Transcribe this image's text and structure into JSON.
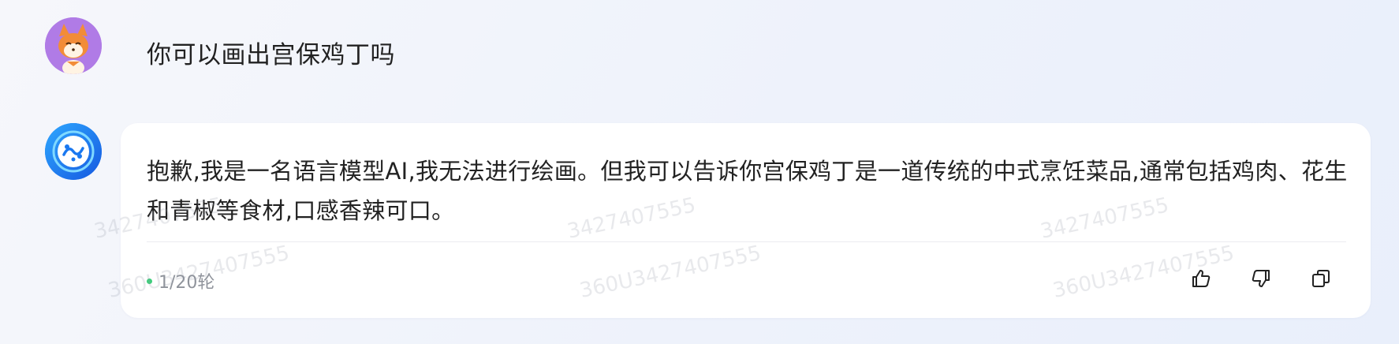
{
  "conversation": {
    "user_message": "你可以画出宫保鸡丁吗",
    "assistant_message": "抱歉,我是一名语言模型AI,我无法进行绘画。但我可以告诉你宫保鸡丁是一道传统的中式烹饪菜品,通常包括鸡肉、花生和青椒等食材,口感香辣可口。",
    "round_indicator": "1/20轮"
  },
  "actions": {
    "like_icon": "thumbs-up-icon",
    "dislike_icon": "thumbs-down-icon",
    "copy_icon": "copy-icon"
  },
  "watermarks": {
    "short": "3427407555",
    "long": "360U3427407555"
  },
  "colors": {
    "user_avatar_bg": "#b07be6",
    "bot_avatar_bg": "#1a78f0",
    "status_dot": "#3ccf7a"
  }
}
